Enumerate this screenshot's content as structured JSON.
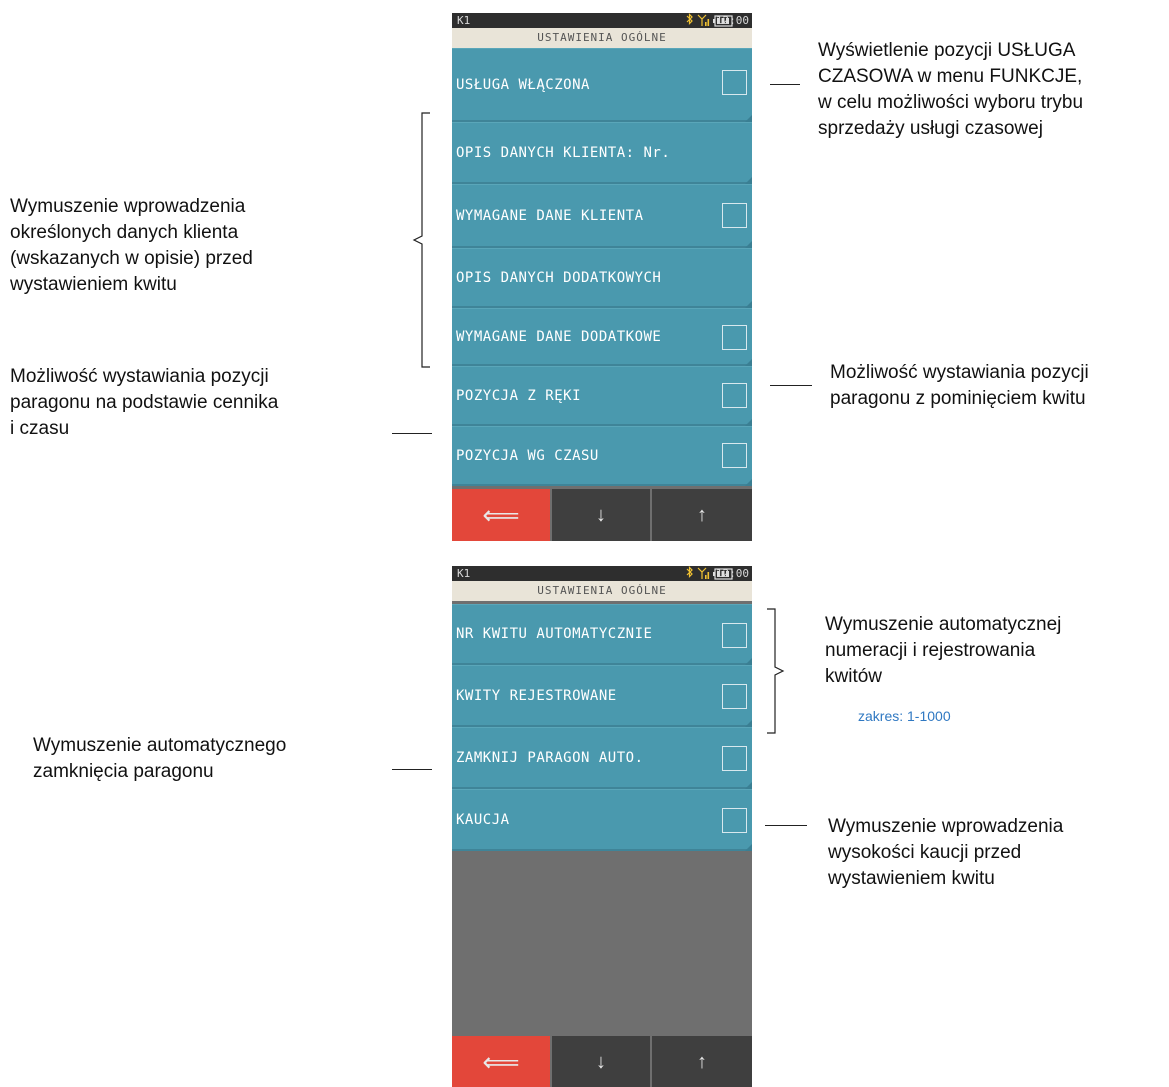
{
  "screen1": {
    "status": {
      "terminal": "K1",
      "time": "12:00"
    },
    "title": "USTAWIENIA OGÓLNE",
    "items": [
      {
        "label": "USŁUGA WŁĄCZONA",
        "checkbox": true
      },
      {
        "label": "OPIS DANYCH KLIENTA: Nr.",
        "checkbox": false
      },
      {
        "label": "WYMAGANE DANE KLIENTA",
        "checkbox": true
      },
      {
        "label": "OPIS DANYCH DODATKOWYCH",
        "checkbox": false
      },
      {
        "label": "WYMAGANE DANE DODATKOWE",
        "checkbox": true
      },
      {
        "label": "POZYCJA Z RĘKI",
        "checkbox": true
      },
      {
        "label": "POZYCJA WG CZASU",
        "checkbox": true
      }
    ],
    "nav": {
      "back": "⟸",
      "down": "↓",
      "up": "↑"
    }
  },
  "screen2": {
    "status": {
      "terminal": "K1",
      "time": "12:00"
    },
    "title": "USTAWIENIA OGÓLNE",
    "items": [
      {
        "label": "NR KWITU AUTOMATYCZNIE",
        "checkbox": true
      },
      {
        "label": "KWITY REJESTROWANE",
        "checkbox": true
      },
      {
        "label": "ZAMKNIJ PARAGON AUTO.",
        "checkbox": true
      },
      {
        "label": "KAUCJA",
        "checkbox": true
      }
    ],
    "nav": {
      "back": "⟸",
      "down": "↓",
      "up": "↑"
    }
  },
  "annotations": {
    "usluga_line1": "Wyświetlenie pozycji USŁUGA",
    "usluga_line2": "CZASOWA w menu FUNKCJE,",
    "usluga_line3": "w celu możliwości wyboru trybu",
    "usluga_line4": "sprzedaży usługi czasowej",
    "klient_line1": "Wymuszenie wprowadzenia",
    "klient_line2": "określonych danych klienta",
    "klient_line3": "(wskazanych w opisie) przed",
    "klient_line4": "wystawieniem kwitu",
    "reki_line1": "Możliwość wystawiania pozycji",
    "reki_line2": "paragonu z pominięciem kwitu",
    "czas_line1": "Możliwość wystawiania pozycji",
    "czas_line2": "paragonu na podstawie cennika",
    "czas_line3": "i  czasu",
    "numeracja_line1": "Wymuszenie automatycznej",
    "numeracja_line2": "numeracji i rejestrowania",
    "numeracja_line3": "kwitów",
    "numeracja_range": "zakres: 1-1000",
    "zamkniecie_line1": "Wymuszenie automatycznego",
    "zamkniecie_line2": "zamknięcia paragonu",
    "kaucja_line1": "Wymuszenie wprowadzenia",
    "kaucja_line2": "wysokości kaucji przed",
    "kaucja_line3": "wystawieniem kwitu"
  },
  "colors": {
    "item_bg": "#4a99ae",
    "back_button": "#e3473a",
    "nav_bg": "#3f3f3f",
    "title_bg": "#e9e4d8",
    "range_text": "#2f78c2"
  }
}
